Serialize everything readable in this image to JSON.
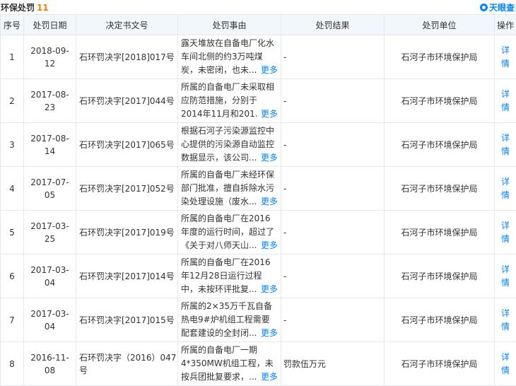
{
  "page": {
    "title": "环保处罚",
    "count": "11",
    "brand": "天眼查"
  },
  "table": {
    "columns": [
      "序号",
      "处罚日期",
      "决定书文号",
      "处罚事由",
      "处罚结果",
      "处罚单位",
      "操作"
    ],
    "more_label": "更多",
    "op_label": "详情",
    "rows": [
      {
        "idx": "1",
        "date": "2018-09-12",
        "doc": "石环罚决字[2018]017号",
        "reason": "露天堆放在自备电厂化水车间北侧的约3万吨煤炭，未密闭，也未...",
        "result": "-",
        "unit": "石河子市环境保护局"
      },
      {
        "idx": "2",
        "date": "2017-08-23",
        "doc": "石环罚决字[2017]044号",
        "reason": "所属的自备电厂未采取相应防范措施，分别于2014年11月和201...",
        "result": "-",
        "unit": "石河子市环境保护局"
      },
      {
        "idx": "3",
        "date": "2017-08-14",
        "doc": "石环罚决字[2017]065号",
        "reason": "根据石河子污染源监控中心提供的污染源自动监控数据显示，该公司...",
        "result": "-",
        "unit": "石河子市环境保护局"
      },
      {
        "idx": "4",
        "date": "2017-07-05",
        "doc": "石环罚决字[2017]052号",
        "reason": "所属的自备电厂未经环保部门批准，擅自拆除水污染处理设施（废水...",
        "result": "-",
        "unit": "石河子市环境保护局"
      },
      {
        "idx": "5",
        "date": "2017-03-25",
        "doc": "石环罚决字[2017]019号",
        "reason": "所属的自备电厂在2016年度的运行时间，超过了《关于对八师天山...",
        "result": "-",
        "unit": "石河子市环境保护局"
      },
      {
        "idx": "6",
        "date": "2017-03-04",
        "doc": "石环罚决字[2017]014号",
        "reason": "所属的自备电厂在2016年12月28日运行过程中，未按环评批复...",
        "result": "-",
        "unit": "石河子市环境保护局"
      },
      {
        "idx": "7",
        "date": "2017-03-04",
        "doc": "石环罚决字[2017]015号",
        "reason": "所属的2×35万千瓦自备热电9#炉机组工程需要配套建设的全封闭...",
        "result": "-",
        "unit": "石河子市环境保护局"
      },
      {
        "idx": "8",
        "date": "2016-11-08",
        "doc": "石环罚决字（2016）047号",
        "reason": "所属的自备电厂一期4*350MW机组工程，未按兵团批复要求，...",
        "result": "罚款伍万元",
        "unit": "石河子市环境保护局"
      }
    ]
  }
}
